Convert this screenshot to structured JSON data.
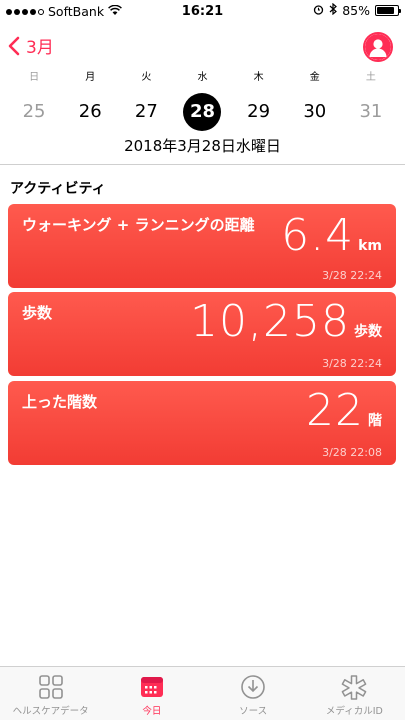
{
  "status_bar": {
    "carrier": "SoftBank",
    "time": "16:21",
    "battery": "85%",
    "battery_level": 0.85
  },
  "nav": {
    "back_label": "3月"
  },
  "week": {
    "weekdays": [
      "日",
      "月",
      "火",
      "水",
      "木",
      "金",
      "土"
    ],
    "days": [
      "25",
      "26",
      "27",
      "28",
      "29",
      "30",
      "31"
    ],
    "full_date": "2018年3月28日水曜日"
  },
  "activity": {
    "heading": "アクティビティ",
    "cards": [
      {
        "title": "ウォーキング + ランニングの距離",
        "value": "6.4",
        "unit": "km",
        "timestamp": "3/28 22:24"
      },
      {
        "title": "歩数",
        "value": "10,258",
        "unit": "歩数",
        "timestamp": "3/28 22:24"
      },
      {
        "title": "上った階数",
        "value": "22",
        "unit": "階",
        "timestamp": "3/28 22:08"
      }
    ]
  },
  "tabbar": {
    "tabs": [
      {
        "label": "ヘルスケアデータ",
        "icon": "grid-icon"
      },
      {
        "label": "今日",
        "icon": "calendar-icon"
      },
      {
        "label": "ソース",
        "icon": "download-icon"
      },
      {
        "label": "メディカルID",
        "icon": "asterisk-icon"
      }
    ]
  },
  "colors": {
    "accent": "#ff2d55",
    "card": "#f5473c"
  }
}
